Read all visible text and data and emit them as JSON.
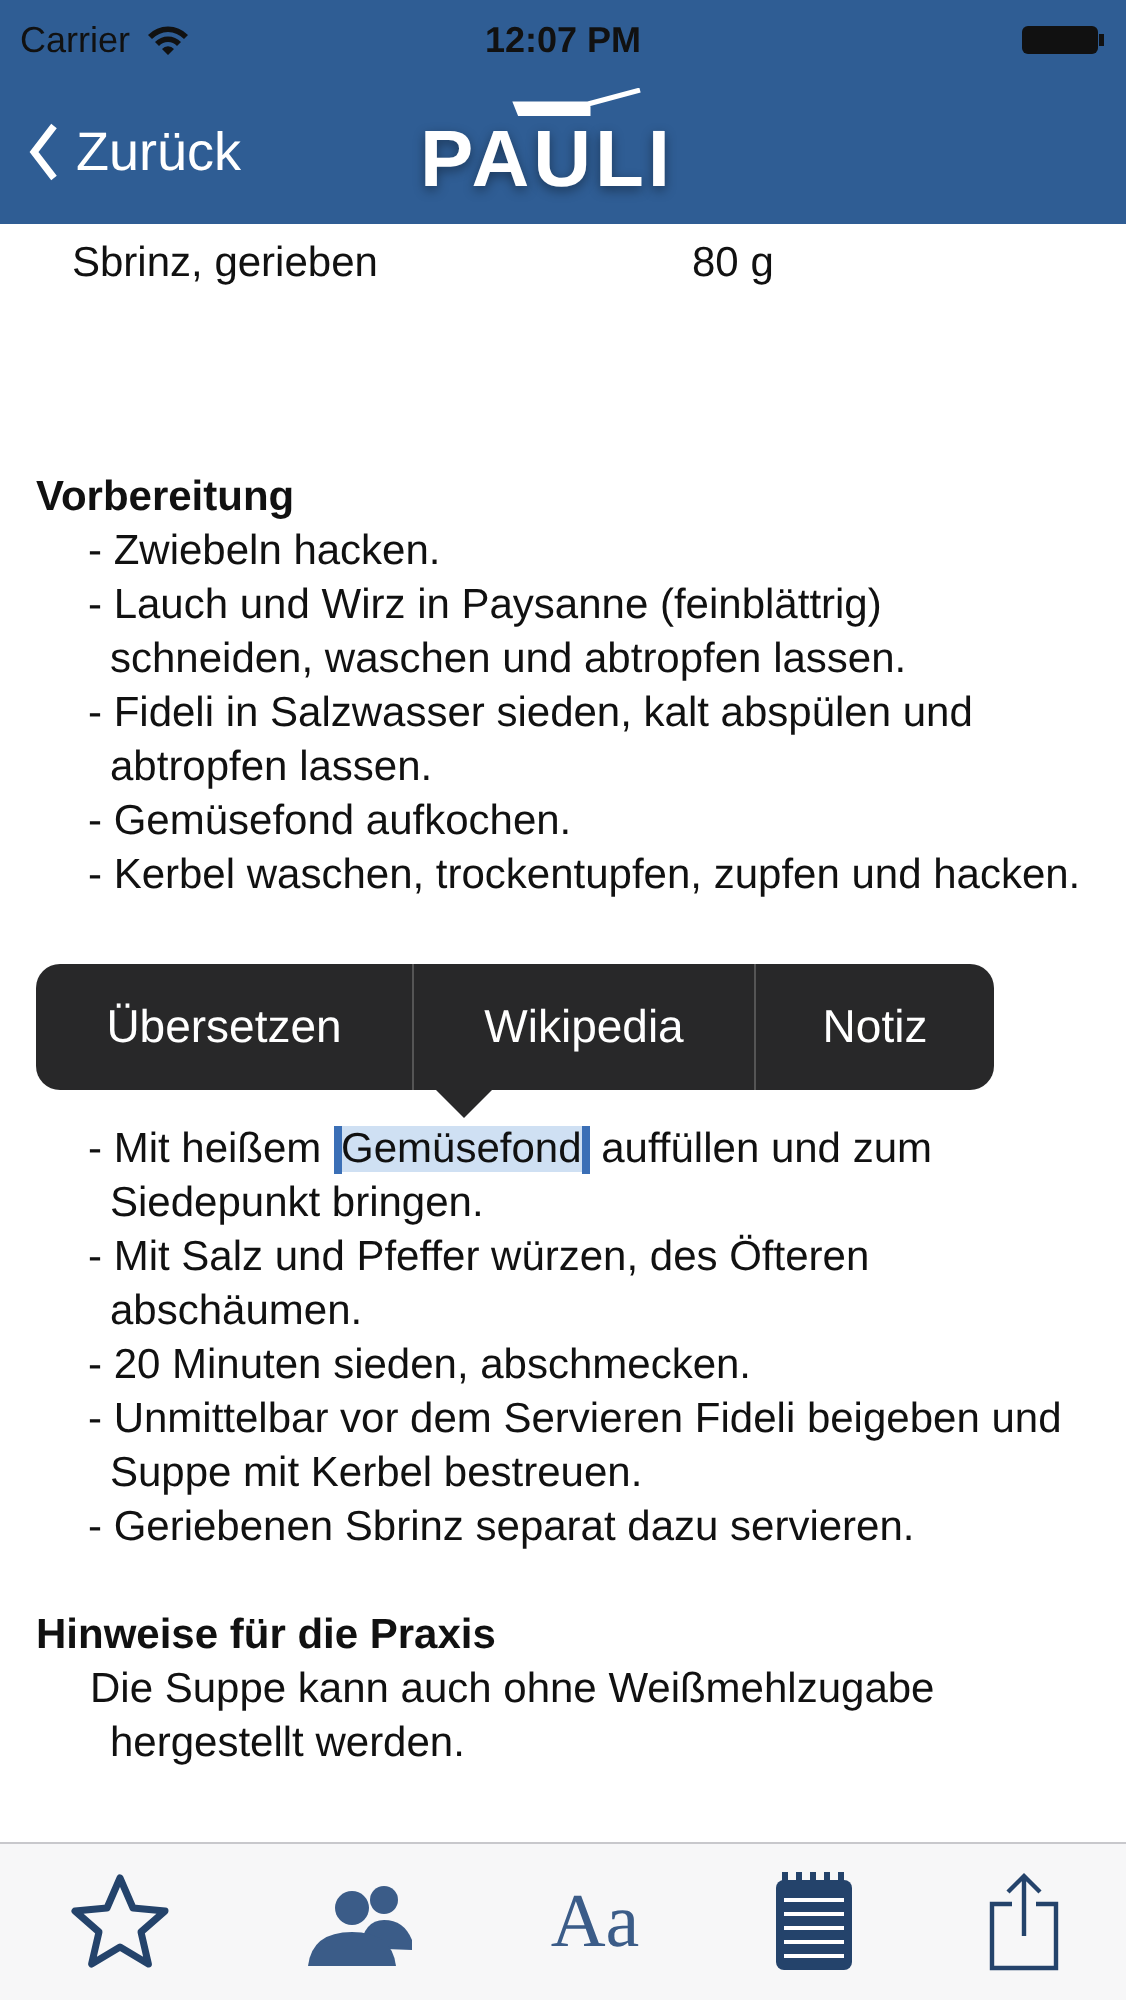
{
  "status_bar": {
    "carrier": "Carrier",
    "time": "12:07 PM"
  },
  "nav": {
    "back": "Zurück",
    "logo": "PAULI"
  },
  "ingredient": {
    "name": "Sbrinz, gerieben",
    "amount": "80 g"
  },
  "sections": [
    {
      "heading": "Vorbereitung",
      "steps": [
        {
          "parts": [
            {
              "text": "- Zwiebeln hacken.",
              "selected": false
            }
          ]
        },
        {
          "parts": [
            {
              "text": "- Lauch und Wirz in Paysanne (feinblättrig)\nschneiden, waschen und abtropfen lassen.",
              "selected": false
            }
          ]
        },
        {
          "parts": [
            {
              "text": "- Fideli in Salzwasser sieden, kalt abspülen und\nabtropfen lassen.",
              "selected": false
            }
          ]
        },
        {
          "parts": [
            {
              "text": "- Gemüsefond aufkochen.",
              "selected": false
            }
          ]
        },
        {
          "parts": [
            {
              "text": "- Kerbel waschen, trockentupfen, zupfen und hacken.",
              "selected": false
            }
          ]
        }
      ]
    },
    {
      "steps": [
        {
          "parts": [
            {
              "text": "- Mit heißem ",
              "selected": false
            },
            {
              "text": "Gemüsefond",
              "selected": true
            },
            {
              "text": " auffüllen und zum\nSiedepunkt bringen.",
              "selected": false
            }
          ]
        },
        {
          "parts": [
            {
              "text": "- Mit Salz und Pfeffer würzen, des Öfteren\nabschäumen.",
              "selected": false
            }
          ]
        },
        {
          "parts": [
            {
              "text": "- 20 Minuten sieden, abschmecken.",
              "selected": false
            }
          ]
        },
        {
          "parts": [
            {
              "text": "- Unmittelbar vor dem Servieren Fideli beigeben und\nSuppe mit Kerbel bestreuen.",
              "selected": false
            }
          ]
        },
        {
          "parts": [
            {
              "text": "- Geriebenen Sbrinz separat dazu servieren.",
              "selected": false
            }
          ]
        }
      ]
    },
    {
      "heading": "Hinweise für die Praxis",
      "paragraph": "Die Suppe kann auch ohne Weißmehlzugabe\nhergestellt werden."
    }
  ],
  "popover": [
    "Übersetzen",
    "Wikipedia",
    "Notiz"
  ],
  "toolbar": [
    {
      "kind": "star"
    },
    {
      "kind": "people"
    },
    {
      "kind": "font",
      "label": "Aa"
    },
    {
      "kind": "notes"
    },
    {
      "kind": "share"
    }
  ]
}
